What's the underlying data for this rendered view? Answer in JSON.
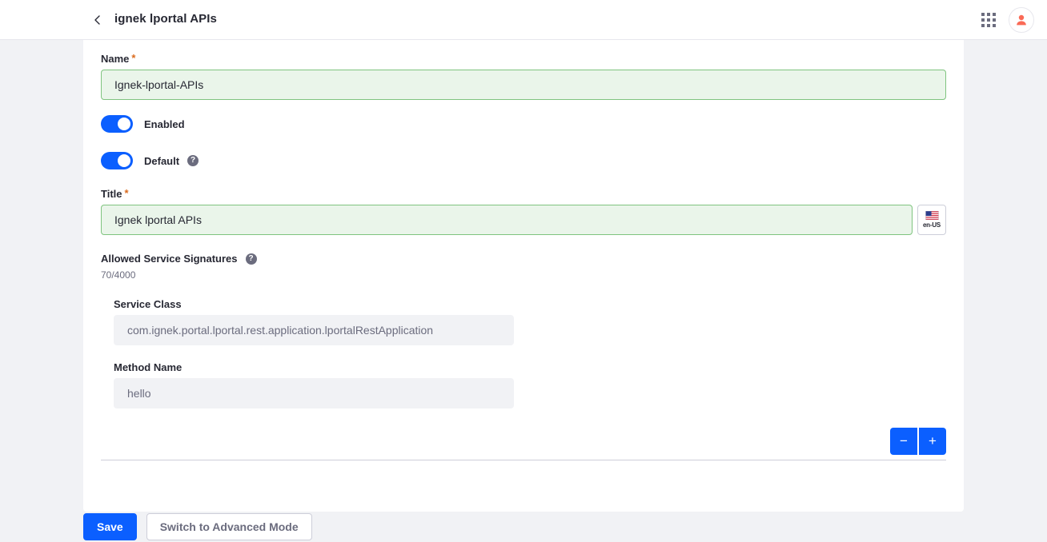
{
  "header": {
    "back_icon": "chevron-left-icon",
    "title": "ignek lportal APIs",
    "apps_icon": "grid-apps-icon",
    "avatar_icon": "user-avatar-icon"
  },
  "form": {
    "name": {
      "label": "Name",
      "required_mark": "*",
      "value": "Ignek-lportal-APIs",
      "placeholder": "Name"
    },
    "enabled": {
      "label": "Enabled",
      "state": "on"
    },
    "default": {
      "label": "Default",
      "state": "on",
      "help_icon": "question-circle-icon",
      "help_glyph": "?"
    },
    "title": {
      "label": "Title",
      "required_mark": "*",
      "value": "Ignek lportal APIs",
      "placeholder": "Title",
      "language_code": "en-US",
      "language_flag": "us-flag-icon"
    },
    "allowed_service_signatures": {
      "label": "Allowed Service Signatures",
      "help_icon": "question-circle-icon",
      "help_glyph": "?",
      "counter": "70/4000"
    },
    "signature": {
      "service_class": {
        "label": "Service Class",
        "value": "com.ignek.portal.lportal.rest.application.lportalRestApplication",
        "placeholder": "Service Class"
      },
      "method_name": {
        "label": "Method Name",
        "value": "hello",
        "placeholder": "Method Name"
      }
    },
    "stepper": {
      "minus_label": "−",
      "plus_label": "+"
    }
  },
  "footer": {
    "save_label": "Save",
    "advanced_label": "Switch to Advanced Mode"
  },
  "colors": {
    "primary": "#0b5fff",
    "page_bg": "#f1f2f5",
    "field_valid_bg": "#eaf5ea",
    "field_valid_border": "#7fc47f",
    "required": "#da6b1e",
    "muted_text": "#6b6c7e",
    "avatar_glyph": "#fa6a56"
  }
}
